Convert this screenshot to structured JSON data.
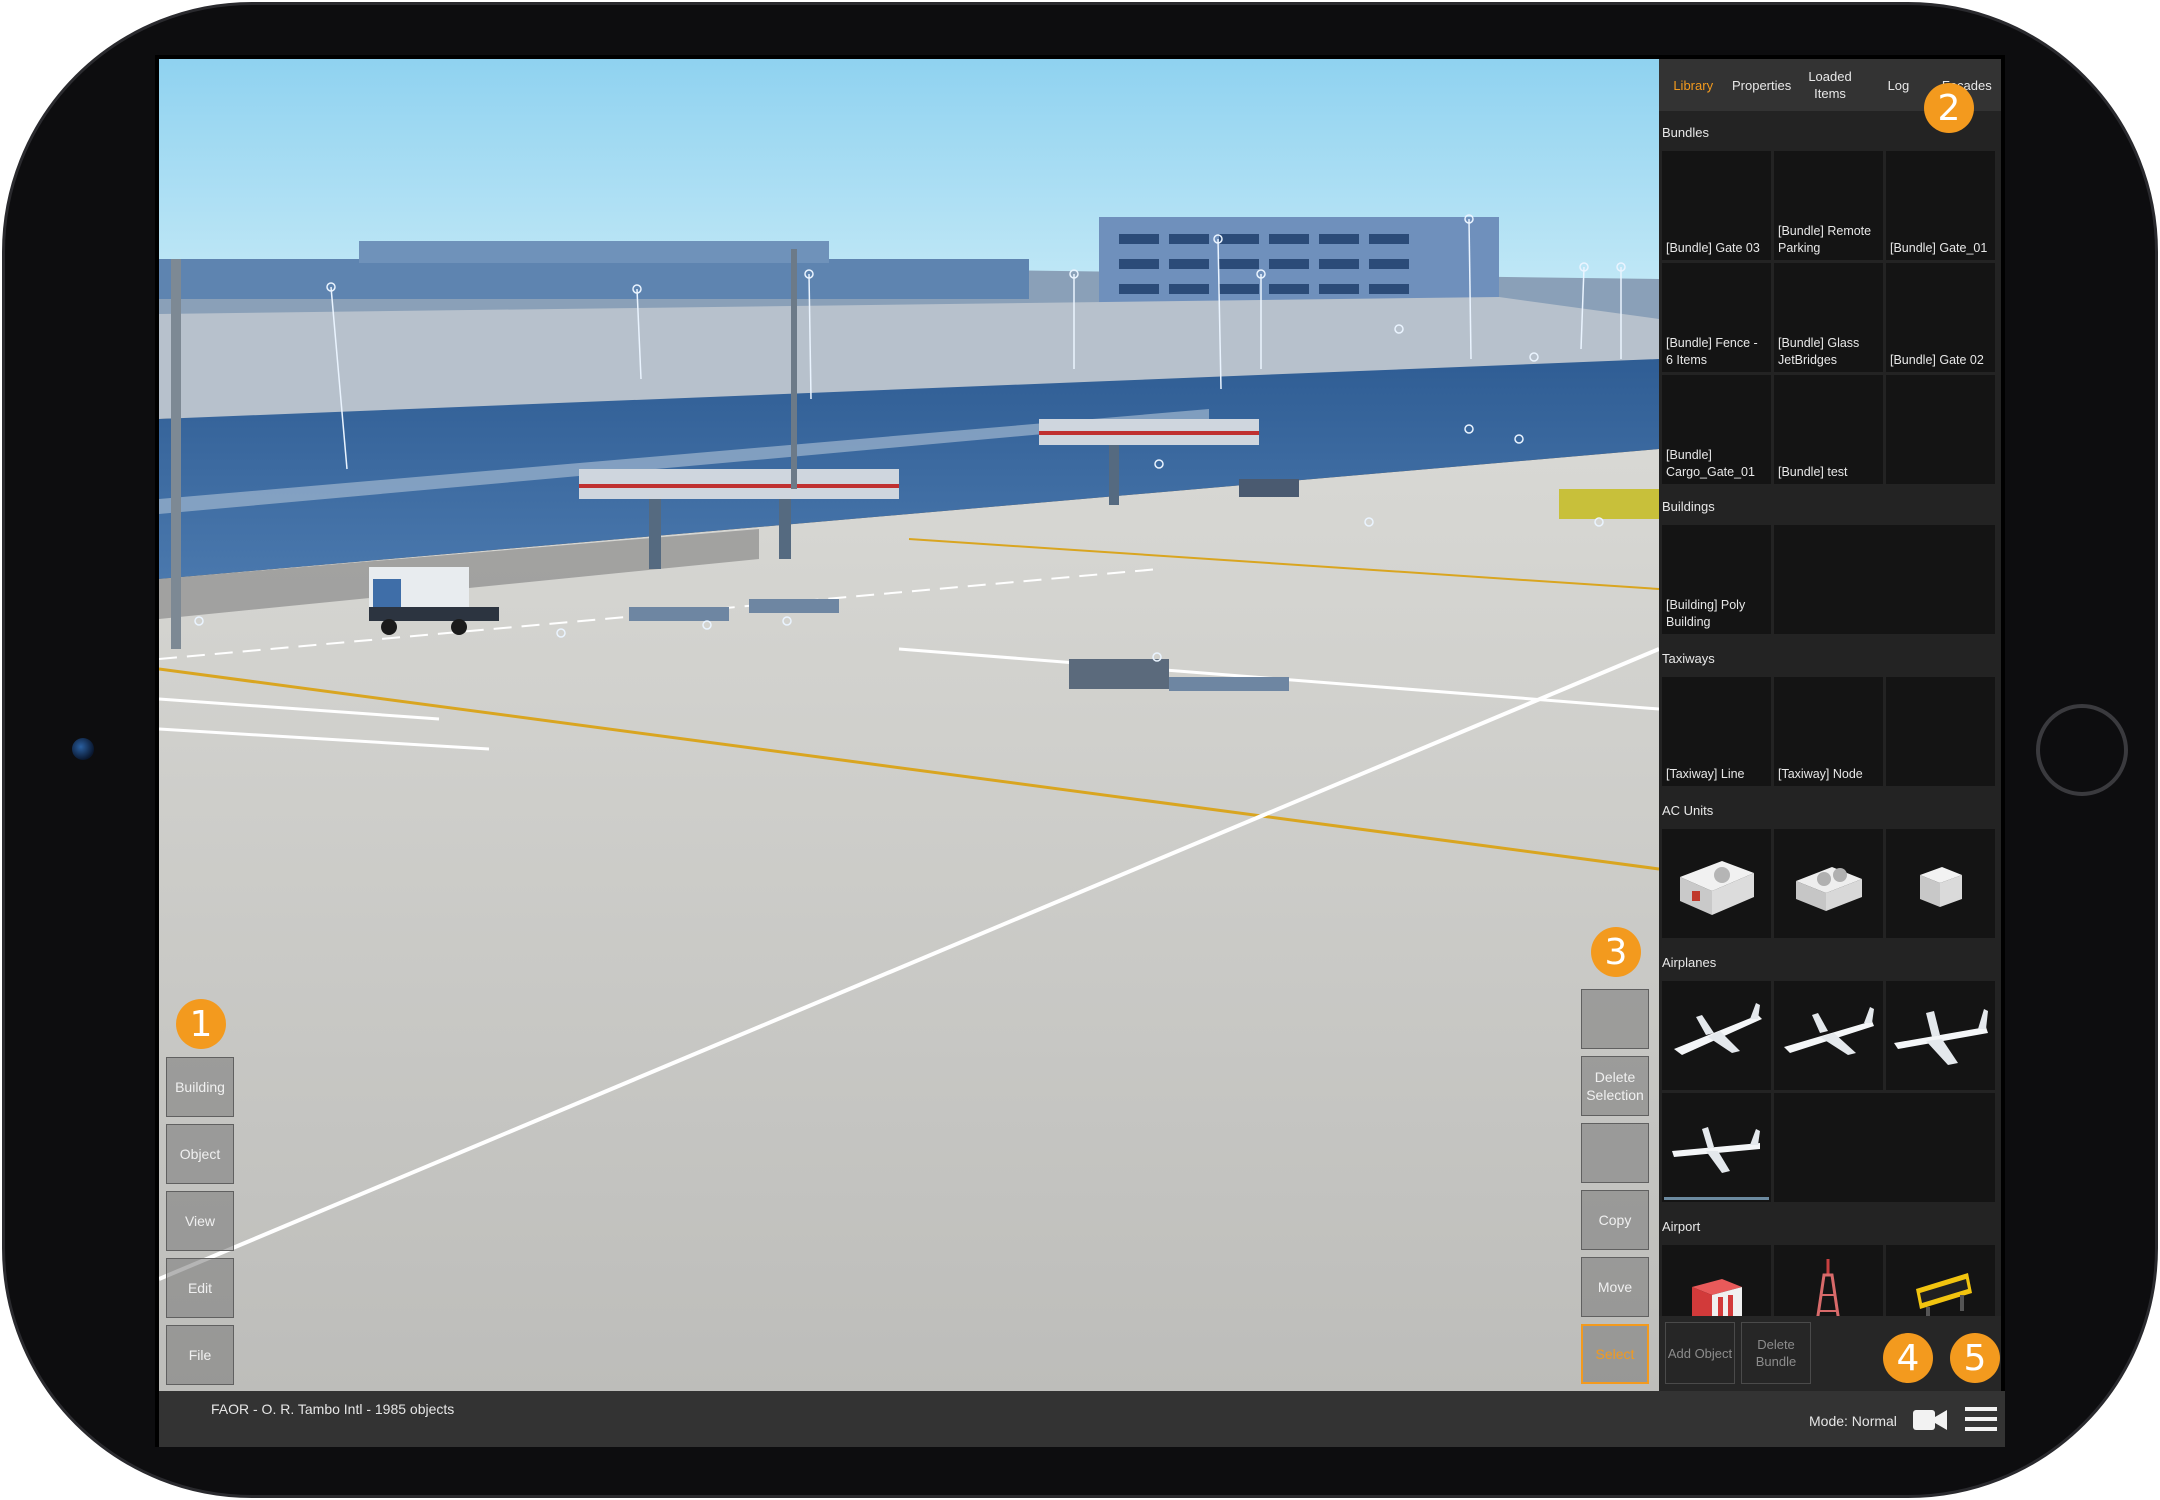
{
  "viewport_markers": [
    "1",
    "2",
    "3",
    "4",
    "5"
  ],
  "left_toolbar": {
    "items": [
      "Building",
      "Object",
      "View",
      "Edit",
      "File"
    ]
  },
  "right_toolbar": {
    "items": [
      "",
      "Delete Selection",
      "",
      "Copy",
      "Move",
      "Select"
    ],
    "active_index": 5
  },
  "panel": {
    "tabs": [
      "Library",
      "Properties",
      "Loaded Items",
      "Log",
      "Facades"
    ],
    "active_tab": "Library",
    "sections": {
      "bundles": {
        "title": "Bundles",
        "items": [
          "[Bundle] Gate 03",
          "[Bundle] Remote Parking",
          "[Bundle] Gate_01",
          "[Bundle] Fence - 6 Items",
          "[Bundle] Glass JetBridges",
          "[Bundle] Gate 02",
          "[Bundle] Cargo_Gate_01",
          "[Bundle] test"
        ]
      },
      "buildings": {
        "title": "Buildings",
        "items": [
          "[Building] Poly Building"
        ]
      },
      "taxiways": {
        "title": "Taxiways",
        "items": [
          "[Taxiway] Line",
          "[Taxiway] Node"
        ]
      },
      "ac_units": {
        "title": "AC Units",
        "icons": [
          "ac-unit-large-icon",
          "ac-unit-medium-icon",
          "ac-unit-small-icon"
        ]
      },
      "airplanes": {
        "title": "Airplanes",
        "icons": [
          "airplane-regional-icon",
          "airplane-narrowbody-icon",
          "airplane-widebody-icon",
          "airplane-trijet-icon"
        ]
      },
      "airport": {
        "title": "Airport",
        "icons": [
          "airport-hangar-icon",
          "airport-radio-tower-icon",
          "airport-sign-icon"
        ]
      }
    },
    "footer": {
      "add_object": "Add Object",
      "delete_bundle": "Delete Bundle"
    }
  },
  "status_bar": {
    "airport_info": "FAOR - O. R. Tambo Intl - 1985 objects",
    "mode": "Mode: Normal",
    "camera_icon": "video-camera-icon",
    "menu_icon": "hamburger-menu-icon"
  },
  "colors": {
    "accent": "#f39a1e",
    "sky": "#a8dcf2",
    "tarmac": "#c9c9c6",
    "terminal": "#3c6a9c"
  }
}
